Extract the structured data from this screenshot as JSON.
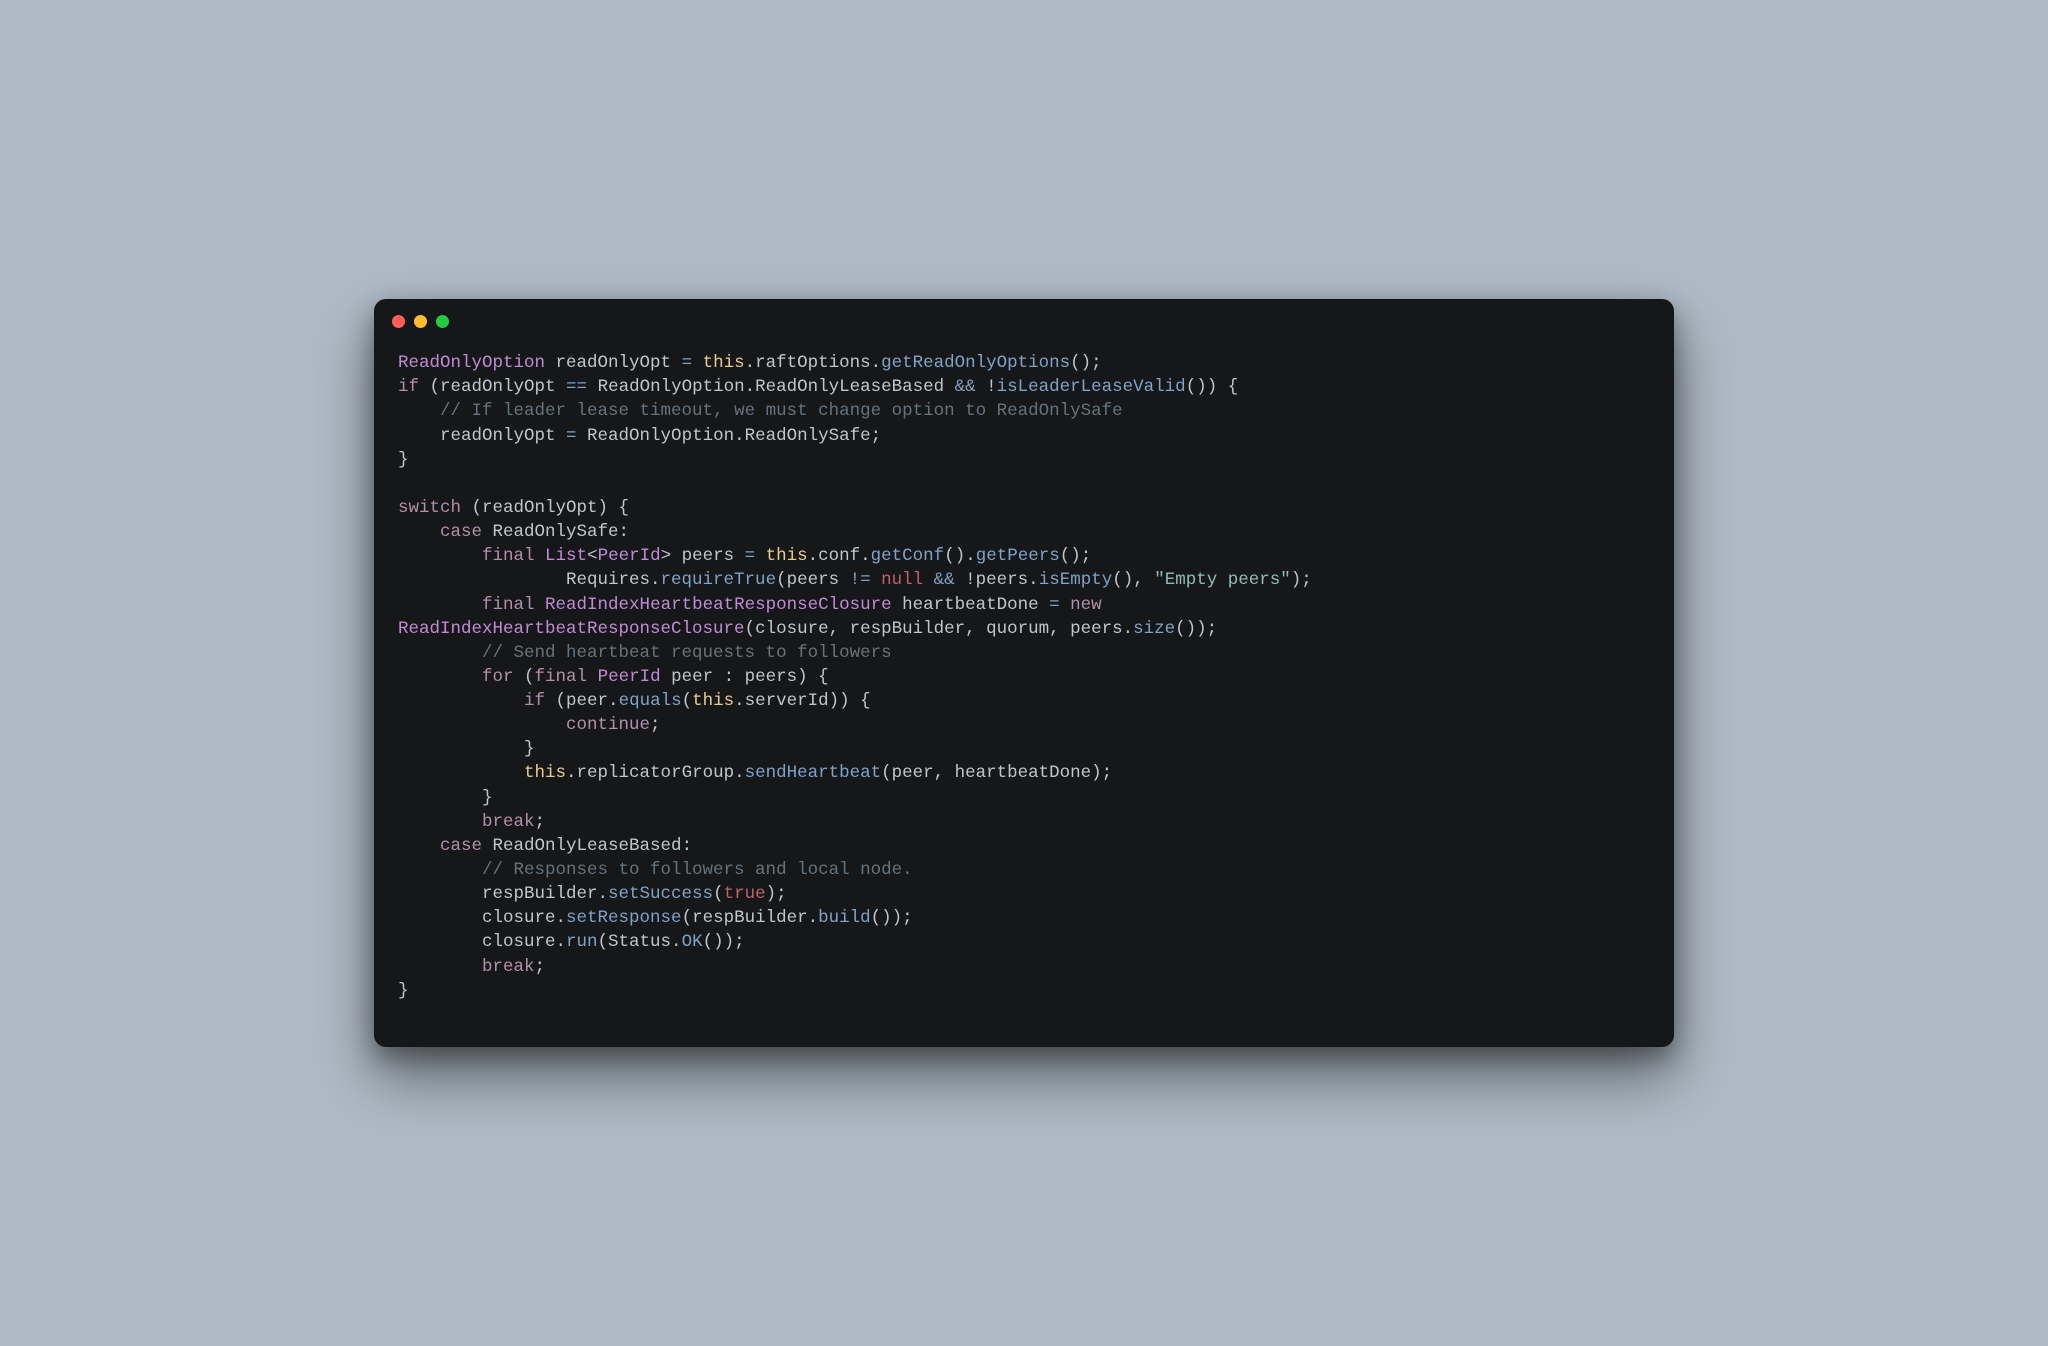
{
  "colors": {
    "bg_page": "#aebac5",
    "bg_window": "#151718",
    "traffic_red": "#ff5f56",
    "traffic_yellow": "#ffbd2e",
    "traffic_green": "#27c93f",
    "fg_default": "#c0c5ce",
    "fg_type": "#c28ad6",
    "fg_keyword": "#b48ead",
    "fg_this": "#ebcb8b",
    "fg_call": "#7fa2c9",
    "fg_null": "#bf616a",
    "fg_string": "#8fbcbb",
    "fg_comment": "#65737e"
  },
  "code": {
    "l01": {
      "t1": "ReadOnlyOption",
      "t2": " readOnlyOpt ",
      "t3": "=",
      "t4": " ",
      "t5": "this",
      "t6": ".raftOptions.",
      "t7": "getReadOnlyOptions",
      "t8": "();"
    },
    "l02": {
      "t1": "if",
      "t2": " (readOnlyOpt ",
      "t3": "==",
      "t4": " ReadOnlyOption.ReadOnlyLeaseBased ",
      "t5": "&&",
      "t6": " !",
      "t7": "isLeaderLeaseValid",
      "t8": "()) {"
    },
    "l03": {
      "t1": "    ",
      "t2": "// If leader lease timeout, we must change option to ReadOnlySafe"
    },
    "l04": {
      "t1": "    readOnlyOpt ",
      "t2": "=",
      "t3": " ReadOnlyOption.ReadOnlySafe;"
    },
    "l05": {
      "t1": "}"
    },
    "l06": {
      "t1": ""
    },
    "l07": {
      "t1": "switch",
      "t2": " (readOnlyOpt) {"
    },
    "l08": {
      "t1": "    ",
      "t2": "case",
      "t3": " ReadOnlySafe:"
    },
    "l09": {
      "t1": "        ",
      "t2": "final",
      "t3": " ",
      "t4": "List",
      "t5": "<",
      "t6": "PeerId",
      "t7": "> peers ",
      "t8": "=",
      "t9": " ",
      "t10": "this",
      "t11": ".conf.",
      "t12": "getConf",
      "t13": "().",
      "t14": "getPeers",
      "t15": "();"
    },
    "l10": {
      "t1": "                Requires.",
      "t2": "requireTrue",
      "t3": "(peers ",
      "t4": "!=",
      "t5": " ",
      "t6": "null",
      "t7": " ",
      "t8": "&&",
      "t9": " !peers.",
      "t10": "isEmpty",
      "t11": "(), ",
      "t12": "\"Empty peers\"",
      "t13": ");"
    },
    "l11": {
      "t1": "        ",
      "t2": "final",
      "t3": " ",
      "t4": "ReadIndexHeartbeatResponseClosure",
      "t5": " heartbeatDone ",
      "t6": "=",
      "t7": " ",
      "t8": "new"
    },
    "l12": {
      "t1": "ReadIndexHeartbeatResponseClosure",
      "t2": "(closure, respBuilder, quorum, peers.",
      "t3": "size",
      "t4": "());"
    },
    "l13": {
      "t1": "        ",
      "t2": "// Send heartbeat requests to followers"
    },
    "l14": {
      "t1": "        ",
      "t2": "for",
      "t3": " (",
      "t4": "final",
      "t5": " ",
      "t6": "PeerId",
      "t7": " peer : peers) {"
    },
    "l15": {
      "t1": "            ",
      "t2": "if",
      "t3": " (peer.",
      "t4": "equals",
      "t5": "(",
      "t6": "this",
      "t7": ".serverId)) {"
    },
    "l16": {
      "t1": "                ",
      "t2": "continue",
      "t3": ";"
    },
    "l17": {
      "t1": "            }"
    },
    "l18": {
      "t1": "            ",
      "t2": "this",
      "t3": ".replicatorGroup.",
      "t4": "sendHeartbeat",
      "t5": "(peer, heartbeatDone);"
    },
    "l19": {
      "t1": "        }"
    },
    "l20": {
      "t1": "        ",
      "t2": "break",
      "t3": ";"
    },
    "l21": {
      "t1": "    ",
      "t2": "case",
      "t3": " ReadOnlyLeaseBased:"
    },
    "l22": {
      "t1": "        ",
      "t2": "// Responses to followers and local node."
    },
    "l23": {
      "t1": "        respBuilder.",
      "t2": "setSuccess",
      "t3": "(",
      "t4": "true",
      "t5": ");"
    },
    "l24": {
      "t1": "        closure.",
      "t2": "setResponse",
      "t3": "(respBuilder.",
      "t4": "build",
      "t5": "());"
    },
    "l25": {
      "t1": "        closure.",
      "t2": "run",
      "t3": "(Status.",
      "t4": "OK",
      "t5": "());"
    },
    "l26": {
      "t1": "        ",
      "t2": "break",
      "t3": ";"
    },
    "l27": {
      "t1": "}"
    }
  }
}
